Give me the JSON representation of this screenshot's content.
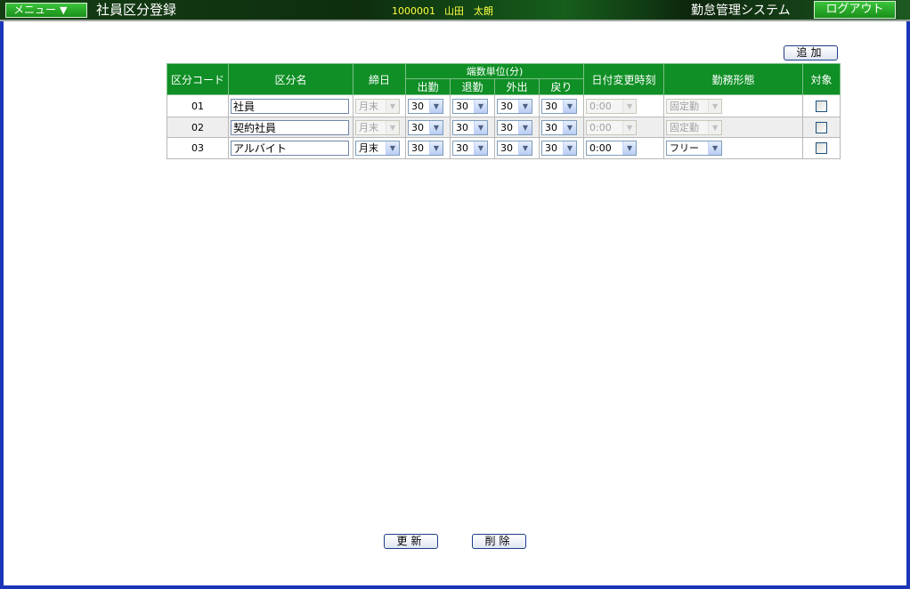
{
  "header": {
    "menu_label": "メニュー",
    "menu_arrow": "▼",
    "page_title": "社員区分登録",
    "user_id": "1000001",
    "user_name": "山田　太朗",
    "system_name": "勤怠管理システム",
    "logout_label": "ログアウト",
    "accent_color": "#0f8f25"
  },
  "toolbar": {
    "add_label": "追加"
  },
  "table": {
    "headers": {
      "code": "区分コード",
      "name": "区分名",
      "closing_day": "締日",
      "rounding_group": "端数単位(分)",
      "clock_in": "出勤",
      "clock_out": "退勤",
      "go_out": "外出",
      "return": "戻り",
      "date_change_time": "日付変更時刻",
      "work_style": "勤務形態",
      "target": "対象"
    },
    "rows": [
      {
        "code": "01",
        "name": "社員",
        "closing_day": "月末",
        "clock_in": "30",
        "clock_out": "30",
        "go_out": "30",
        "return": "30",
        "date_change_time": "0:00",
        "work_style": "固定勤",
        "target_checked": false
      },
      {
        "code": "02",
        "name": "契約社員",
        "closing_day": "月末",
        "clock_in": "30",
        "clock_out": "30",
        "go_out": "30",
        "return": "30",
        "date_change_time": "0:00",
        "work_style": "固定勤",
        "target_checked": false
      },
      {
        "code": "03",
        "name": "アルバイト",
        "closing_day": "月末",
        "clock_in": "30",
        "clock_out": "30",
        "go_out": "30",
        "return": "30",
        "date_change_time": "0:00",
        "work_style": "フリー",
        "target_checked": false
      }
    ]
  },
  "footer": {
    "update_label": "更新",
    "delete_label": "削除"
  },
  "icons": {
    "dropdown": "chevron-down-icon",
    "menu": "triangle-down-icon"
  }
}
